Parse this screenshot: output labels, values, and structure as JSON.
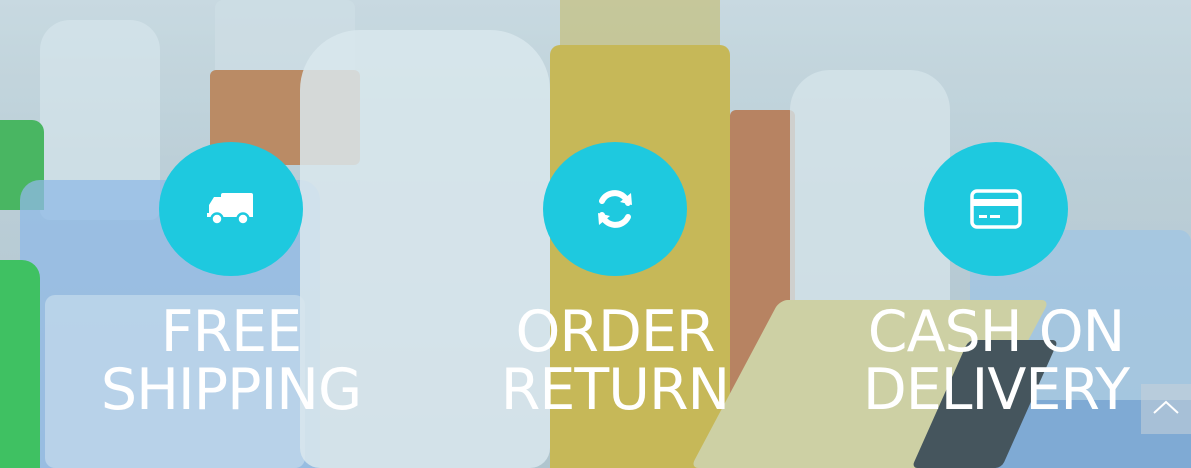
{
  "features": [
    {
      "icon": "truck-icon",
      "title": "FREE\nSHIPPING"
    },
    {
      "icon": "refresh-icon",
      "title": "ORDER\nRETURN"
    },
    {
      "icon": "credit-card-icon",
      "title": "CASH ON\nDELIVERY"
    }
  ],
  "colors": {
    "accent": "#1ec9df",
    "title_text": "#ffffff"
  },
  "scroll_top": {
    "icon": "chevron-up-icon"
  }
}
